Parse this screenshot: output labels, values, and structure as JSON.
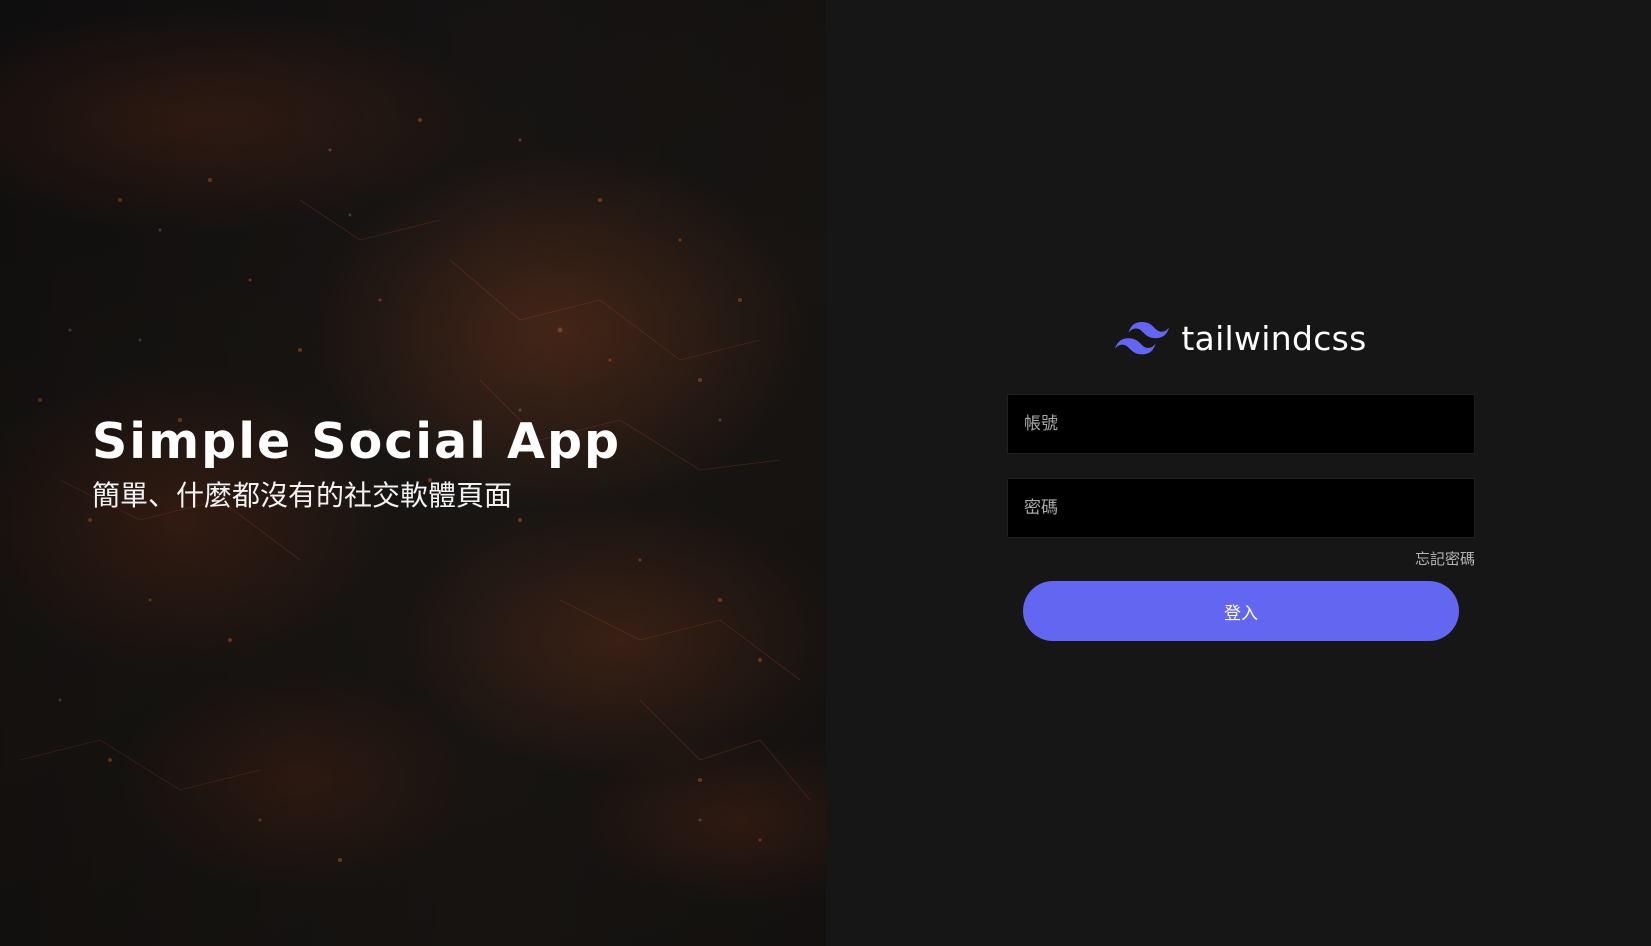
{
  "hero": {
    "title": "Simple Social App",
    "subtitle": "簡單、什麼都沒有的社交軟體頁面"
  },
  "brand": {
    "name": "tailwindcss",
    "icon": "tailwind-wave-icon",
    "icon_color": "#6366f1"
  },
  "login": {
    "account_placeholder": "帳號",
    "password_placeholder": "密碼",
    "forgot_label": "忘記密碼",
    "submit_label": "登入"
  },
  "colors": {
    "accent": "#6366f1",
    "panel_bg": "#161616",
    "input_bg": "#000000"
  }
}
